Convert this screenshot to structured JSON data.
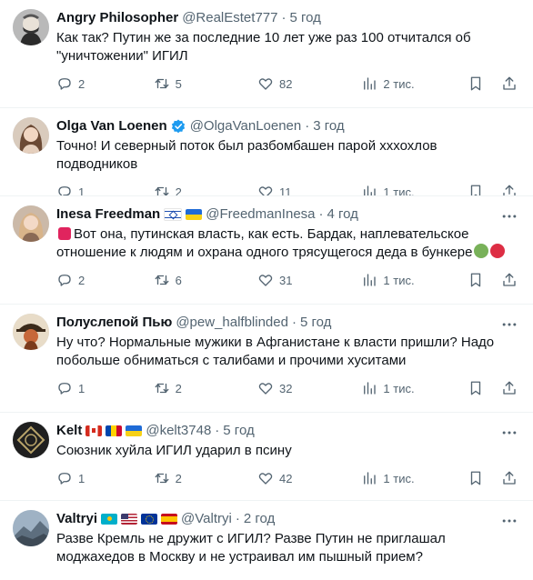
{
  "tweets": [
    {
      "name": "Angry Philosopher",
      "handle": "@RealEstet777",
      "dot": "·",
      "time": "5 год",
      "text": "Как так? Путин же за последние 10 лет уже раз 100 отчитался об \"уничтожении\" ИГИЛ",
      "replies": "2",
      "reposts": "5",
      "likes": "82",
      "views": "2 тис."
    },
    {
      "name": "Olga Van Loenen",
      "handle": "@OlgaVanLoenen",
      "dot": "·",
      "time": "3 год",
      "text": "Точно! И северный поток был разбомбашен парой хххохлов подводников",
      "replies": "1",
      "reposts": "2",
      "likes": "11",
      "views": "1 тис."
    },
    {
      "name": "Inesa Freedman",
      "handle": "@FreedmanInesa",
      "dot": "·",
      "time": "4 год",
      "text": "Вот она, путинская власть, как есть. Бардак, наплевательское отношение к людям и охрана одного трясущегося деда в бункере",
      "replies": "2",
      "reposts": "6",
      "likes": "31",
      "views": "1 тис."
    },
    {
      "name": "Полуслепой Пью",
      "handle": "@pew_halfblinded",
      "dot": "·",
      "time": "5 год",
      "text": "Ну что? Нормальные мужики в Афганистане к власти пришли? Надо побольше обниматься с талибами и прочими хуситами",
      "replies": "1",
      "reposts": "2",
      "likes": "32",
      "views": "1 тис."
    },
    {
      "name": "Kelt",
      "handle": "@kelt3748",
      "dot": "·",
      "time": "5 год",
      "text": "Союзник хуйла ИГИЛ ударил в псину",
      "replies": "1",
      "reposts": "2",
      "likes": "42",
      "views": "1 тис."
    },
    {
      "name": "Valtryi",
      "handle": "@Valtryi",
      "dot": "·",
      "time": "2 год",
      "text": "Разве Кремль не дружит с ИГИЛ? Разве Путин не приглашал моджахедов в Москву и не устраивал им пышный прием?"
    }
  ],
  "colors": {
    "text": "#0f1419",
    "secondary": "#536471",
    "verified": "#1d9bf0",
    "divider": "#eff3f4"
  },
  "icons": [
    "reply-icon",
    "repost-icon",
    "like-icon",
    "views-icon",
    "bookmark-icon",
    "share-icon",
    "more-icon",
    "verified-icon"
  ]
}
